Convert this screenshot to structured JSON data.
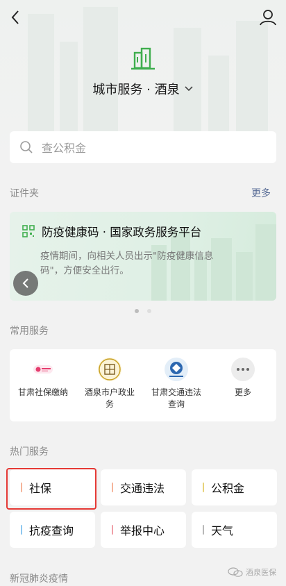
{
  "header": {
    "city_title": "城市服务 · 酒泉"
  },
  "search": {
    "placeholder": "查公积金"
  },
  "documents": {
    "section_title": "证件夹",
    "more_label": "更多",
    "card": {
      "title": "防疫健康码 · 国家政务服务平台",
      "description": "疫情期间，向相关人员出示\"防疫健康信息码\"，方便安全出行。"
    }
  },
  "common_services": {
    "section_title": "常用服务",
    "items": [
      {
        "label": "甘肃社保缴纳",
        "icon": "gansu-social-security-icon"
      },
      {
        "label": "酒泉市户政业务",
        "icon": "jiuquan-household-icon"
      },
      {
        "label": "甘肃交通违法查询",
        "icon": "gansu-traffic-police-icon"
      },
      {
        "label": "更多",
        "icon": "more-dots-icon"
      }
    ]
  },
  "hot_services": {
    "section_title": "热门服务",
    "items": [
      {
        "label": "社保",
        "accent": "#f5b49a"
      },
      {
        "label": "交通违法",
        "accent": "#f5b49a"
      },
      {
        "label": "公积金",
        "accent": "#e7d27a"
      },
      {
        "label": "抗疫查询",
        "accent": "#8ec8f0"
      },
      {
        "label": "举报中心",
        "accent": "#f0a0a8"
      },
      {
        "label": "天气",
        "accent": "#b8b8b8"
      }
    ]
  },
  "epidemic": {
    "section_title": "新冠肺炎疫情"
  },
  "watermark": {
    "text": "酒泉医保"
  },
  "colors": {
    "accent_green": "#4caf50",
    "link_blue": "#576b95",
    "highlight_red": "#e53935"
  }
}
